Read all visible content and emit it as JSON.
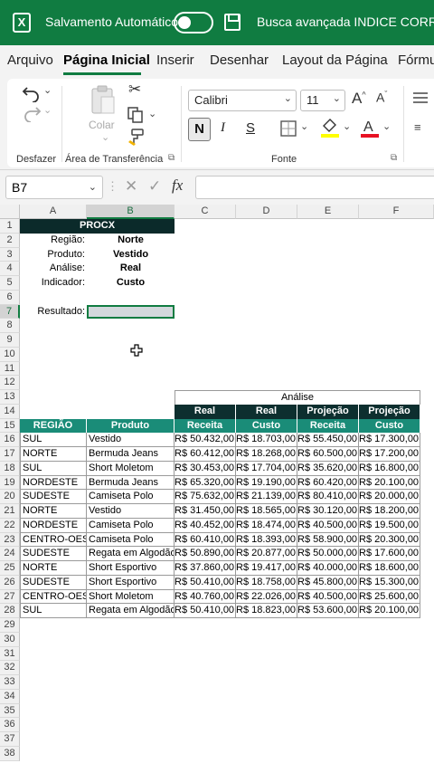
{
  "titlebar": {
    "app_icon": "excel-icon",
    "autosave_label": "Salvamento Automático",
    "autosave_state": "off",
    "document_title": "Busca avançada INDICE CORRESP -"
  },
  "ribbon_tabs": [
    "Arquivo",
    "Página Inicial",
    "Inserir",
    "Desenhar",
    "Layout da Página",
    "Fórmu"
  ],
  "active_tab": "Página Inicial",
  "ribbon": {
    "undo_group_label": "Desfazer",
    "clipboard_label": "Área de Transferência",
    "paste_label": "Colar",
    "font_group_label": "Fonte",
    "font_name": "Calibri",
    "font_size": "11",
    "bold_label": "N",
    "italic_label": "I",
    "underline_label": "S",
    "font_color": "#e81123",
    "highlight_color": "#ffff00"
  },
  "formula_bar": {
    "name_box": "B7",
    "fx_label": "fx",
    "formula": ""
  },
  "columns": [
    "A",
    "B",
    "C",
    "D",
    "E",
    "F"
  ],
  "selected_column": "B",
  "selected_row": "7",
  "rows": [
    "1",
    "2",
    "3",
    "4",
    "5",
    "6",
    "7",
    "8",
    "9",
    "10",
    "11",
    "12",
    "13",
    "14",
    "15",
    "16",
    "17",
    "18",
    "19",
    "20",
    "21",
    "22",
    "23",
    "24",
    "25",
    "26",
    "27",
    "28",
    "29",
    "30",
    "31",
    "32",
    "33",
    "34",
    "35",
    "36",
    "37",
    "38"
  ],
  "procx": {
    "header": "PROCX",
    "params": [
      {
        "label": "Região:",
        "value": "Norte"
      },
      {
        "label": "Produto:",
        "value": "Vestido"
      },
      {
        "label": "Análise:",
        "value": "Real"
      },
      {
        "label": "Indicador:",
        "value": "Custo"
      }
    ],
    "result_label": "Resultado:",
    "result_value": ""
  },
  "table": {
    "analise_label": "Análise",
    "group_headers": [
      "Real",
      "Real",
      "Projeção",
      "Projeção"
    ],
    "headers": [
      "REGIÃO",
      "Produto",
      "Receita",
      "Custo",
      "Receita",
      "Custo"
    ],
    "data": [
      [
        "SUL",
        "Vestido",
        "R$ 50.432,00",
        "R$ 18.703,00",
        "R$ 55.450,00",
        "R$ 17.300,00"
      ],
      [
        "NORTE",
        "Bermuda Jeans",
        "R$ 60.412,00",
        "R$ 18.268,00",
        "R$ 60.500,00",
        "R$ 17.200,00"
      ],
      [
        "SUL",
        "Short Moletom",
        "R$ 30.453,00",
        "R$ 17.704,00",
        "R$ 35.620,00",
        "R$ 16.800,00"
      ],
      [
        "NORDESTE",
        "Bermuda Jeans",
        "R$ 65.320,00",
        "R$ 19.190,00",
        "R$ 60.420,00",
        "R$ 20.100,00"
      ],
      [
        "SUDESTE",
        "Camiseta Polo",
        "R$ 75.632,00",
        "R$ 21.139,00",
        "R$ 80.410,00",
        "R$ 20.000,00"
      ],
      [
        "NORTE",
        "Vestido",
        "R$ 31.450,00",
        "R$ 18.565,00",
        "R$ 30.120,00",
        "R$ 18.200,00"
      ],
      [
        "NORDESTE",
        "Camiseta Polo",
        "R$ 40.452,00",
        "R$ 18.474,00",
        "R$ 40.500,00",
        "R$ 19.500,00"
      ],
      [
        "CENTRO-OESTE",
        "Camiseta Polo",
        "R$ 60.410,00",
        "R$ 18.393,00",
        "R$ 58.900,00",
        "R$ 20.300,00"
      ],
      [
        "SUDESTE",
        "Regata em Algodão",
        "R$ 50.890,00",
        "R$ 20.877,00",
        "R$ 50.000,00",
        "R$ 17.600,00"
      ],
      [
        "NORTE",
        "Short Esportivo",
        "R$ 37.860,00",
        "R$ 19.417,00",
        "R$ 40.000,00",
        "R$ 18.600,00"
      ],
      [
        "SUDESTE",
        "Short Esportivo",
        "R$ 50.410,00",
        "R$ 18.758,00",
        "R$ 45.800,00",
        "R$ 15.300,00"
      ],
      [
        "CENTRO-OESTE",
        "Short Moletom",
        "R$ 40.760,00",
        "R$ 22.026,00",
        "R$ 40.500,00",
        "R$ 25.600,00"
      ],
      [
        "SUL",
        "Regata em Algodão",
        "R$ 50.410,00",
        "R$ 18.823,00",
        "R$ 53.600,00",
        "R$ 20.100,00"
      ]
    ]
  },
  "colors": {
    "excel_green": "#107c41",
    "header_dark": "#0d2f2f",
    "header_teal": "#1a8c78"
  }
}
